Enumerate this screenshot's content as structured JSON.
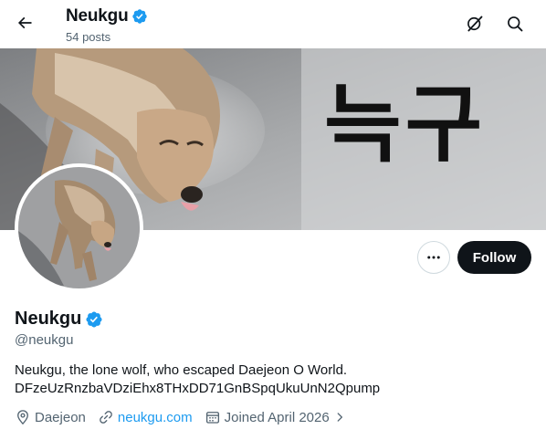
{
  "header": {
    "title": "Neukgu",
    "posts_count": "54 posts",
    "back_icon": "arrow-left-icon",
    "grok_icon": "grok-icon",
    "search_icon": "search-icon"
  },
  "banner": {
    "text": "늑구",
    "description_icon": "wolf-photo"
  },
  "profile": {
    "display_name": "Neukgu",
    "handle": "@neukgu",
    "verified_color": "#1d9bf0",
    "bio_lines": [
      "Neukgu, the lone wolf, who escaped Daejeon O World.",
      "DFzeUzRnzbaVDziEhx8THxDD71GnBSpqUkuUnN2Qpump"
    ],
    "location": "Daejeon",
    "website": "neukgu.com",
    "joined": "Joined April 2026"
  },
  "actions": {
    "follow_label": "Follow",
    "more_label": "···"
  },
  "colors": {
    "accent": "#1d9bf0",
    "text_primary": "#0f1419",
    "text_secondary": "#536471",
    "follow_bg": "#0f1419"
  }
}
